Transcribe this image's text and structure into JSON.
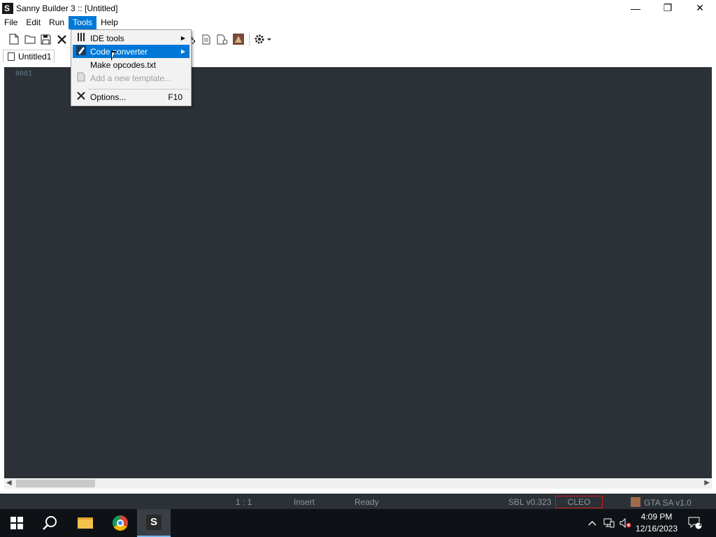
{
  "window": {
    "title": "Sanny Builder 3 :: [Untitled]",
    "minimize": "—",
    "restore": "❐",
    "close": "✕"
  },
  "menubar": {
    "items": [
      "File",
      "Edit",
      "Run",
      "Tools",
      "Help"
    ],
    "active": "Tools"
  },
  "toolbar": {
    "icons": [
      "new-file-icon",
      "open-folder-icon",
      "save-icon",
      "close-file-icon",
      "compile-gear-icon",
      "document-icon",
      "document-gear-icon",
      "game-icon",
      "settings-gear-icon"
    ]
  },
  "tab": {
    "label": "Untitled1"
  },
  "editor": {
    "line_number": "0001"
  },
  "tools_menu": {
    "items": [
      {
        "label": "IDE tools",
        "icon": "tools-icon",
        "submenu": true,
        "shortcut": "",
        "state": "normal"
      },
      {
        "label": "Code converter",
        "icon": "pen-icon",
        "submenu": true,
        "shortcut": "",
        "state": "highlighted"
      },
      {
        "label": "Make opcodes.txt",
        "icon": "",
        "submenu": false,
        "shortcut": "",
        "state": "normal"
      },
      {
        "label": "Add a new template...",
        "icon": "template-icon",
        "submenu": false,
        "shortcut": "",
        "state": "disabled"
      },
      {
        "label": "Options...",
        "icon": "wrench-icon",
        "submenu": false,
        "shortcut": "F10",
        "state": "normal"
      }
    ]
  },
  "statusbar": {
    "position": "1 :  1",
    "mode": "Insert",
    "status": "Ready",
    "sbl_version": "SBL v0.323",
    "cleo": "CLEO",
    "game": "GTA SA v1.0"
  },
  "taskbar": {
    "time": "4:09 PM",
    "date": "12/16/2023",
    "notification_count": "1"
  },
  "colors": {
    "editor_bg": "#2b3136",
    "menu_highlight": "#0078d7",
    "cleo_border": "#d01a1a"
  }
}
